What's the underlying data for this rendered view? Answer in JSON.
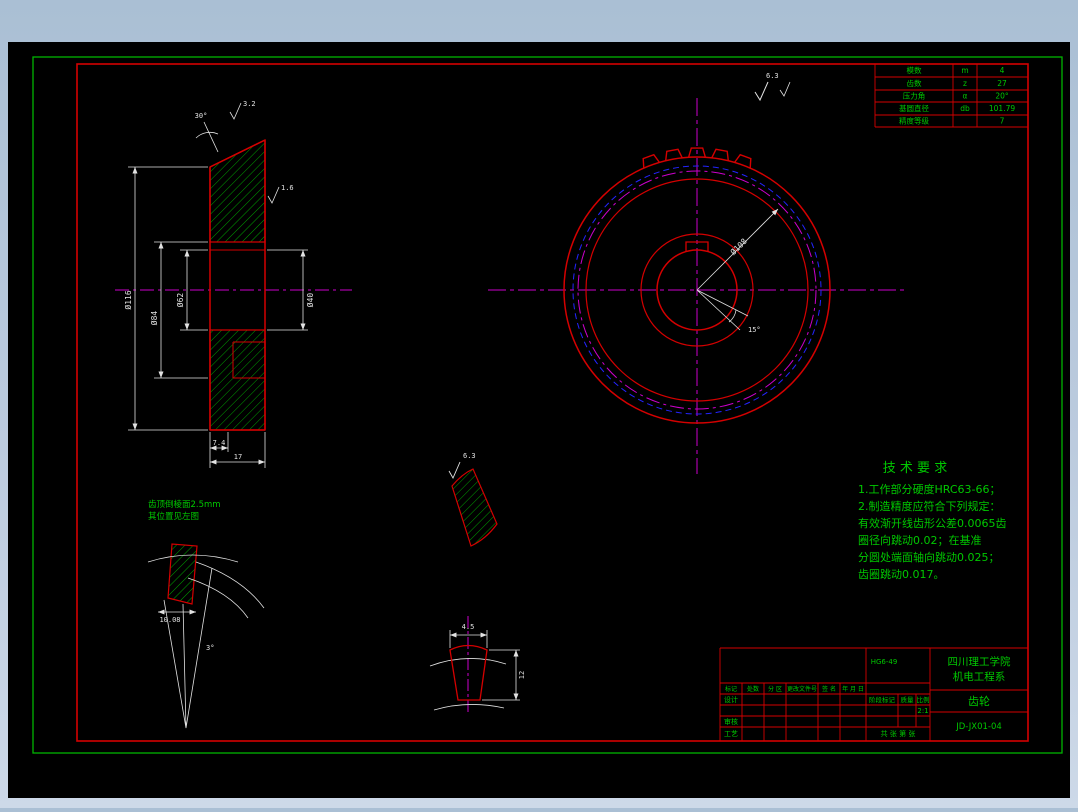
{
  "colors": {
    "background": "#b7c6d8",
    "canvas": "#000000",
    "frame_green": "#00b400",
    "sheet_red": "#d40000",
    "dimension_white": "#e2e2e2",
    "hatch_green": "#00a000",
    "centerline_magenta": "#cc00cc",
    "pitch_blue": "#2424ff",
    "text_green": "#00c800"
  },
  "param_table": {
    "rows": [
      {
        "label": "模数",
        "symbol": "m",
        "value": "4"
      },
      {
        "label": "齿数",
        "symbol": "z",
        "value": "27"
      },
      {
        "label": "压力角",
        "symbol": "α",
        "value": "20°"
      },
      {
        "label": "基圆直径",
        "symbol": "db",
        "value": "101.79"
      },
      {
        "label": "精度等级",
        "symbol": "",
        "value": "7"
      }
    ]
  },
  "tech_req": {
    "title": "技 术 要 求",
    "lines": [
      "1.工作部分硬度HRC63-66；",
      "2.制造精度应符合下列规定：",
      "有效渐开线齿形公差0.0065齿",
      "圈径向跳动0.02；在基准",
      "分圆处端面轴向跳动0.025；",
      "齿圈跳动0.017。"
    ]
  },
  "title_block": {
    "school_line1": "四川理工学院",
    "school_line2": "机电工程系",
    "part_name": "齿轮",
    "drawing_no": "JD-JX01-04",
    "code": "HG6-49",
    "rev_headers": [
      "标记",
      "处数",
      "分 区",
      "更改文件号",
      "签 名",
      "年 月 日"
    ],
    "design_label": "设计",
    "check_label": "审核",
    "process_label": "工艺",
    "stage_label": "阶段标记",
    "mass_label": "质量",
    "scale_label": "比例",
    "scale_value": "2:1",
    "sheets_label": "共 张 第 张"
  },
  "annotations": {
    "section": {
      "dia_outer": "Ø116",
      "dia_web": "Ø84",
      "dia_hub": "Ø62",
      "dia_bore": "Ø40",
      "width_rim": "7.4",
      "width_total": "17",
      "chamfer_angle": "30°",
      "rough_top": "3.2",
      "rough_side": "1.6"
    },
    "gear_view": {
      "leader_dim": "Ø108",
      "angle_dim": "15°"
    },
    "detail_chamfer": {
      "note_line1": "齿顶倒棱面2.5mm",
      "note_line2": "其位置见左图",
      "width_dim": "10.08",
      "angle_dim": "3°"
    },
    "detail_tooth_section": {
      "roughness": "6.3"
    },
    "detail_tooth_profile": {
      "top_dim": "4.5",
      "side_dim": "12"
    },
    "general_roughness": "6.3"
  }
}
